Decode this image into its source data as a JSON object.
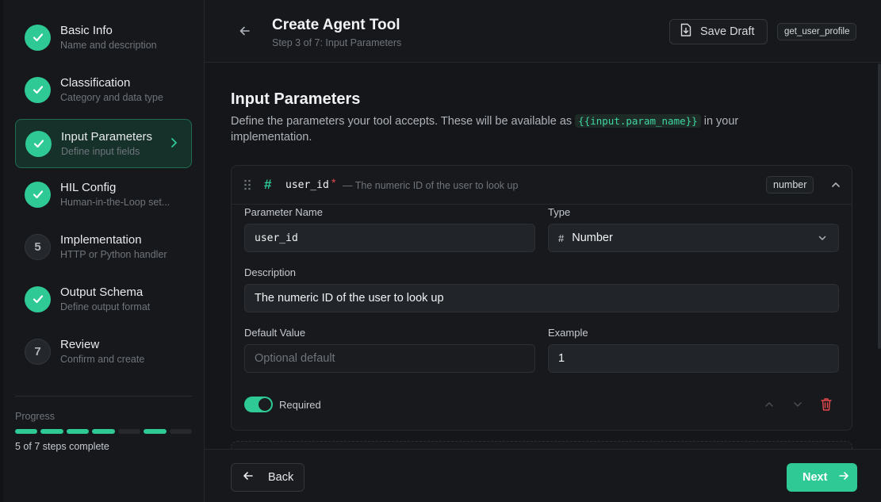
{
  "header": {
    "title": "Create Agent Tool",
    "step_text": "Step 3 of 7: Input Parameters",
    "save_draft_label": "Save Draft",
    "tool_name": "get_user_profile"
  },
  "sidebar": {
    "steps": [
      {
        "title": "Basic Info",
        "subtitle": "Name and description",
        "status": "complete"
      },
      {
        "title": "Classification",
        "subtitle": "Category and data type",
        "status": "complete"
      },
      {
        "title": "Input Parameters",
        "subtitle": "Define input fields",
        "status": "active"
      },
      {
        "title": "HIL Config",
        "subtitle": "Human-in-the-Loop set...",
        "status": "complete"
      },
      {
        "title": "Implementation",
        "subtitle": "HTTP or Python handler",
        "status": "pending",
        "number": "5"
      },
      {
        "title": "Output Schema",
        "subtitle": "Define output format",
        "status": "complete"
      },
      {
        "title": "Review",
        "subtitle": "Confirm and create",
        "status": "pending",
        "number": "7"
      }
    ],
    "progress": {
      "label": "Progress",
      "text": "5 of 7 steps complete",
      "segments": [
        true,
        true,
        true,
        true,
        false,
        true,
        false
      ]
    }
  },
  "section": {
    "title": "Input Parameters",
    "desc_before": "Define the parameters your tool accepts. These will be available as ",
    "code": "{{input.param_name}}",
    "desc_after": " in your implementation."
  },
  "param": {
    "name": "user_id",
    "required_marker": "*",
    "inline_desc": "— The numeric ID of the user to look up",
    "type_badge": "number",
    "labels": {
      "name": "Parameter Name",
      "type": "Type",
      "description": "Description",
      "default": "Default Value",
      "example": "Example"
    },
    "name_value": "user_id",
    "type_value": "Number",
    "description_value": "The numeric ID of the user to look up",
    "default_placeholder": "Optional default",
    "example_value": "1",
    "required_label": "Required",
    "required_on": true
  },
  "footer": {
    "back_label": "Back",
    "next_label": "Next"
  },
  "colors": {
    "accent": "#2ec995",
    "danger": "#e5484d",
    "background": "#141619"
  }
}
